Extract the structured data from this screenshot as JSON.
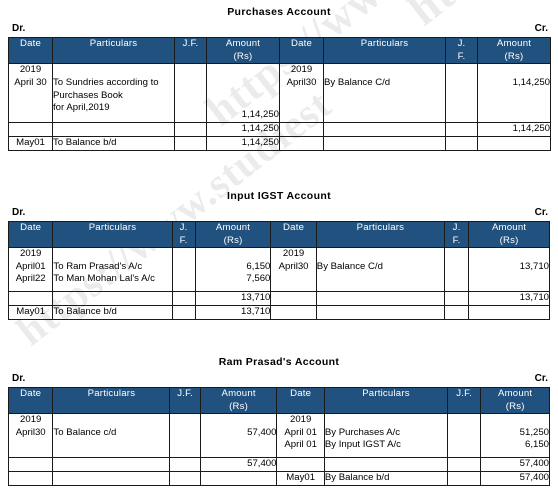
{
  "document": {
    "watermark_text": "https://www.studiest",
    "header_color": "#21527F",
    "border_color": "#1a1a1a"
  },
  "common": {
    "dr_label": "Dr.",
    "cr_label": "Cr.",
    "columns": {
      "date": "Date",
      "particulars": "Particulars",
      "jf": "J.F.",
      "jf_stacked_line1": "J.",
      "jf_stacked_line2": "F.",
      "amount_line1": "Amount",
      "amount_line2": "(Rs)"
    }
  },
  "ledgers": [
    {
      "id": "purchases-account",
      "title": "Purchases  Account",
      "jf_style": "inline",
      "debit": {
        "entry": {
          "date_lines": [
            "2019",
            "April 30"
          ],
          "particulars_lines": [
            "To Sundries according to",
            "Purchases Book",
            "for April,2019"
          ],
          "jf": "",
          "amount": "1,14,250"
        },
        "total": {
          "amount": "1,14,250",
          "bold": false
        },
        "brought_down": {
          "date": "May01",
          "particulars": "To Balance b/d",
          "jf": "",
          "amount": "1,14,250"
        }
      },
      "credit": {
        "entry": {
          "date_lines": [
            "2019",
            "April30"
          ],
          "particulars_lines": [
            "By  Balance C/d"
          ],
          "jf": "",
          "amount": "1,14,250"
        },
        "total": {
          "amount": "1,14,250",
          "bold": false
        },
        "brought_down": {
          "date": "",
          "particulars": "",
          "jf": "",
          "amount": ""
        }
      }
    },
    {
      "id": "input-igst-account",
      "title": "Input IGST Account",
      "jf_style": "stacked",
      "debit": {
        "entry": {
          "date_lines": [
            "2019",
            "April01",
            "April22"
          ],
          "particulars_lines": [
            "",
            "To Ram Prasad's A/c",
            "To Man Mohan Lal's A/c"
          ],
          "jf": "",
          "amount_lines": [
            "",
            "6,150",
            "7,560"
          ]
        },
        "total": {
          "amount": "13,710",
          "bold": false
        },
        "brought_down": {
          "date": "May01",
          "particulars": "To Balance b/d",
          "jf": "",
          "amount": "13,710"
        }
      },
      "credit": {
        "entry": {
          "date_lines": [
            "2019",
            "April30"
          ],
          "particulars_lines": [
            "",
            "By Balance C/d"
          ],
          "jf": "",
          "amount_lines": [
            "",
            "13,710"
          ]
        },
        "total": {
          "amount": "13,710",
          "bold": false
        },
        "brought_down": {
          "date": "",
          "particulars": "",
          "jf": "",
          "amount": ""
        }
      }
    },
    {
      "id": "ram-prasad-account",
      "title": "Ram Prasad's  Account",
      "jf_style": "inline",
      "debit": {
        "entry": {
          "date_lines": [
            "2019",
            "April30"
          ],
          "particulars_lines": [
            "",
            "To Balance c/d"
          ],
          "jf": "",
          "amount_lines": [
            "",
            "57,400"
          ]
        },
        "total": {
          "amount": "57,400",
          "bold": true
        },
        "brought_down": {
          "date": "",
          "particulars": "",
          "jf": "",
          "amount": ""
        }
      },
      "credit": {
        "entry": {
          "date_lines": [
            "2019",
            "April 01",
            "April 01"
          ],
          "particulars_lines": [
            "",
            "By Purchases A/c",
            "By Input IGST A/c"
          ],
          "jf": "",
          "amount_lines": [
            "",
            "51,250",
            "6,150"
          ]
        },
        "total": {
          "amount": "57,400",
          "bold": true
        },
        "brought_down": {
          "date": "May01",
          "particulars": "By Balance b/d",
          "jf": "",
          "amount": "57,400"
        }
      }
    }
  ]
}
